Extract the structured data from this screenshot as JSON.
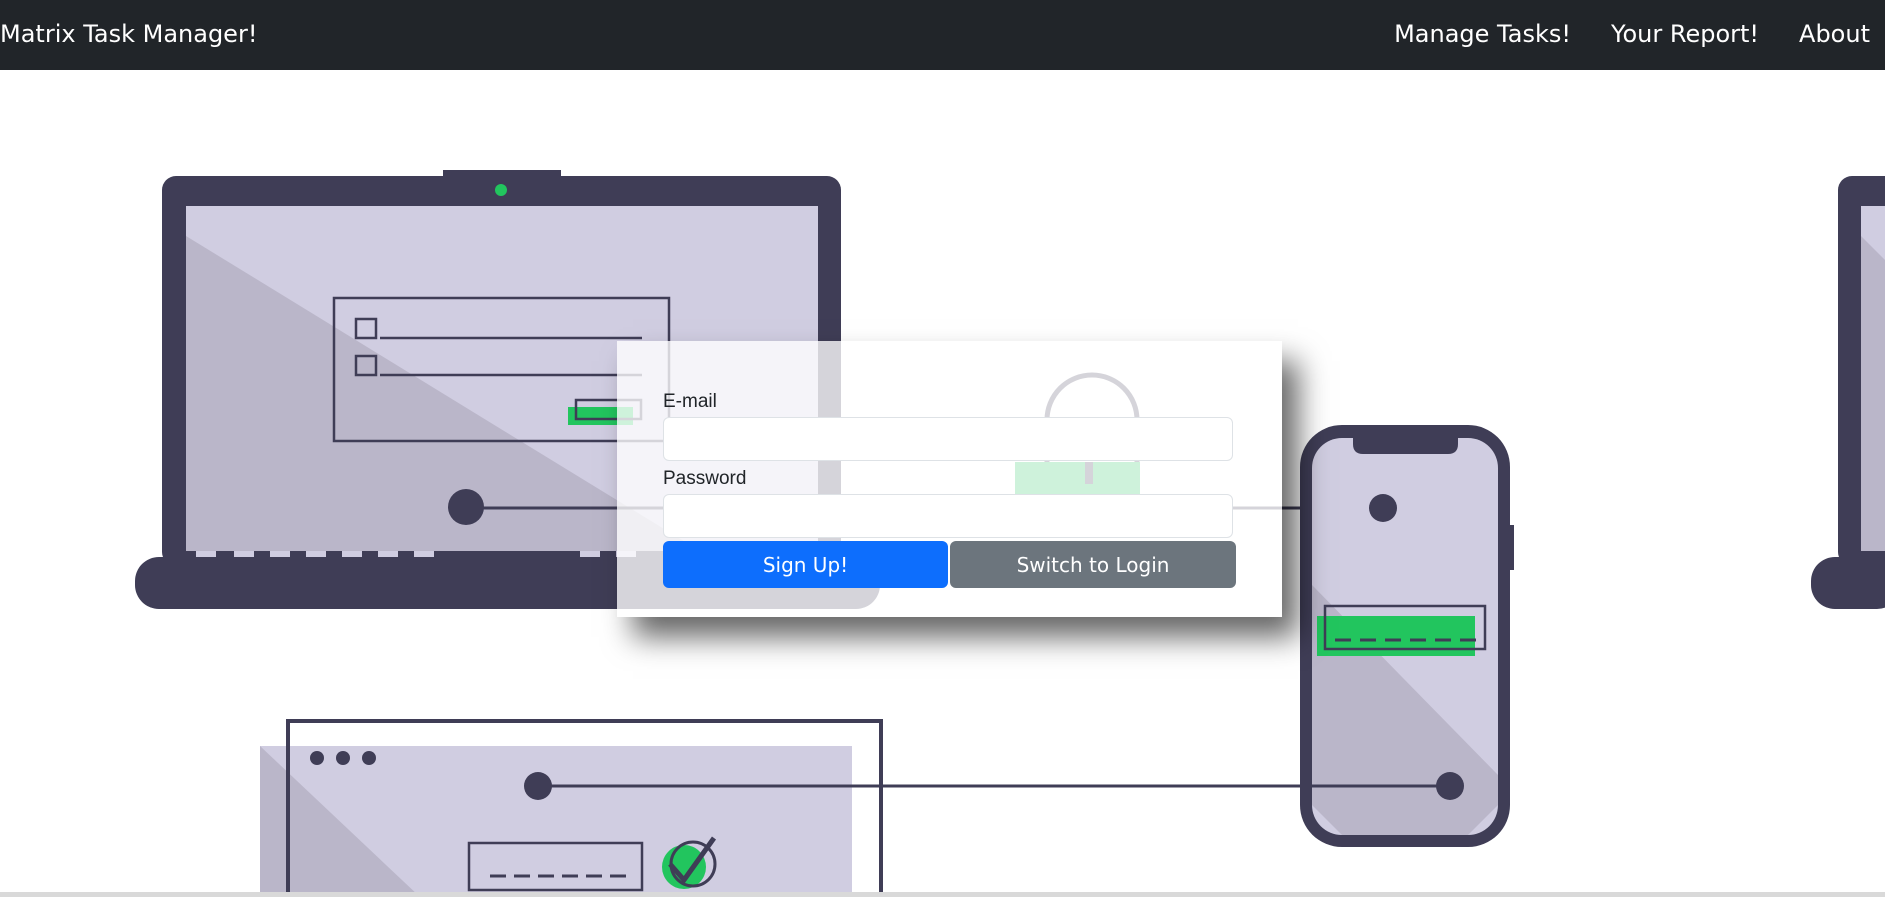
{
  "navbar": {
    "brand": "Matrix Task Manager!",
    "links": [
      {
        "label": "Manage Tasks!"
      },
      {
        "label": "Your Report!"
      },
      {
        "label": "About"
      }
    ]
  },
  "form": {
    "email_label": "E-mail",
    "email_value": "",
    "password_label": "Password",
    "password_value": "",
    "signup_label": "Sign Up!",
    "switch_label": "Switch to Login"
  },
  "illustration": {
    "laptop_form_placeholder": "_____",
    "phone_code": "_ _ _ _ _",
    "browser_code": "_ _ _ _ _"
  },
  "colors": {
    "navbar": "#212529",
    "primary": "#0d6efd",
    "secondary": "#6c757d",
    "device_dark": "#3f3d56",
    "screen": "#d0cde1",
    "accent_green": "#22c55e"
  }
}
